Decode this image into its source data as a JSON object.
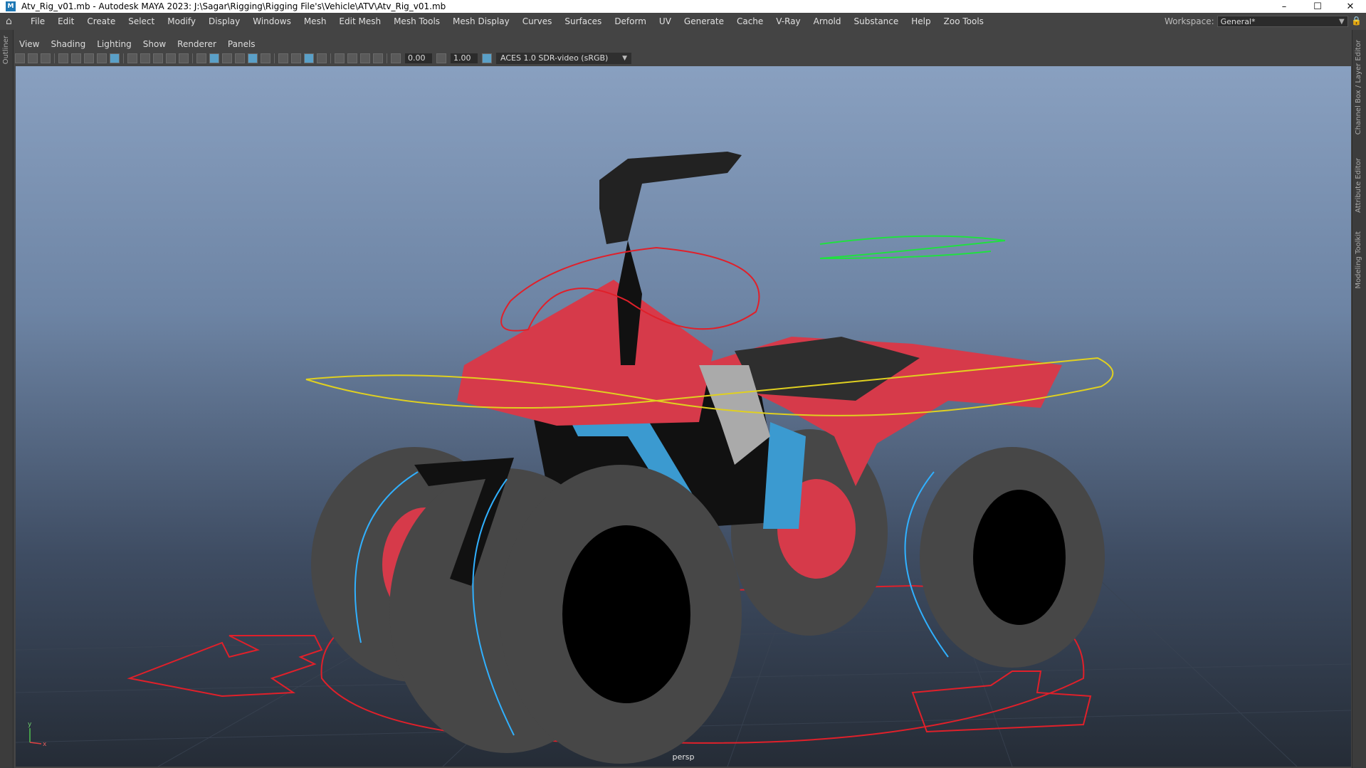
{
  "window": {
    "title": "Atv_Rig_v01.mb - Autodesk MAYA 2023: J:\\Sagar\\Rigging\\Rigging File's\\Vehicle\\ATV\\Atv_Rig_v01.mb",
    "app_icon": "M",
    "minimize_glyph": "–",
    "maximize_glyph": "☐",
    "close_glyph": "✕"
  },
  "menubar": {
    "home_glyph": "⌂",
    "items": [
      "File",
      "Edit",
      "Create",
      "Select",
      "Modify",
      "Display",
      "Windows",
      "Mesh",
      "Edit Mesh",
      "Mesh Tools",
      "Mesh Display",
      "Curves",
      "Surfaces",
      "Deform",
      "UV",
      "Generate",
      "Cache",
      "V-Ray",
      "Arnold",
      "Substance",
      "Help",
      "Zoo Tools"
    ],
    "workspace_label": "Workspace:",
    "workspace_value": "General*",
    "lock_glyph": "🔒"
  },
  "side_tabs": {
    "left": "Outliner",
    "right": [
      "Channel Box / Layer Editor",
      "Attribute Editor",
      "Modeling Toolkit"
    ]
  },
  "panel_menu": [
    "View",
    "Shading",
    "Lighting",
    "Show",
    "Renderer",
    "Panels"
  ],
  "panel_toolbar": {
    "exposure": "0.00",
    "gamma": "1.00",
    "color_space": "ACES 1.0 SDR-video (sRGB)"
  },
  "viewport": {
    "camera": "persp",
    "axis_y": "y",
    "axis_x": "x",
    "colors": {
      "body_red": "#d63a4a",
      "seat": "#2e2e2e",
      "frame_blue": "#3b9ad0",
      "tire": "#4a4a4a",
      "ctrl_red": "#e0202a",
      "ctrl_yellow": "#e0d020",
      "ctrl_green": "#20e040",
      "wheel_ctrl_cyan": "#30b0ff"
    }
  }
}
